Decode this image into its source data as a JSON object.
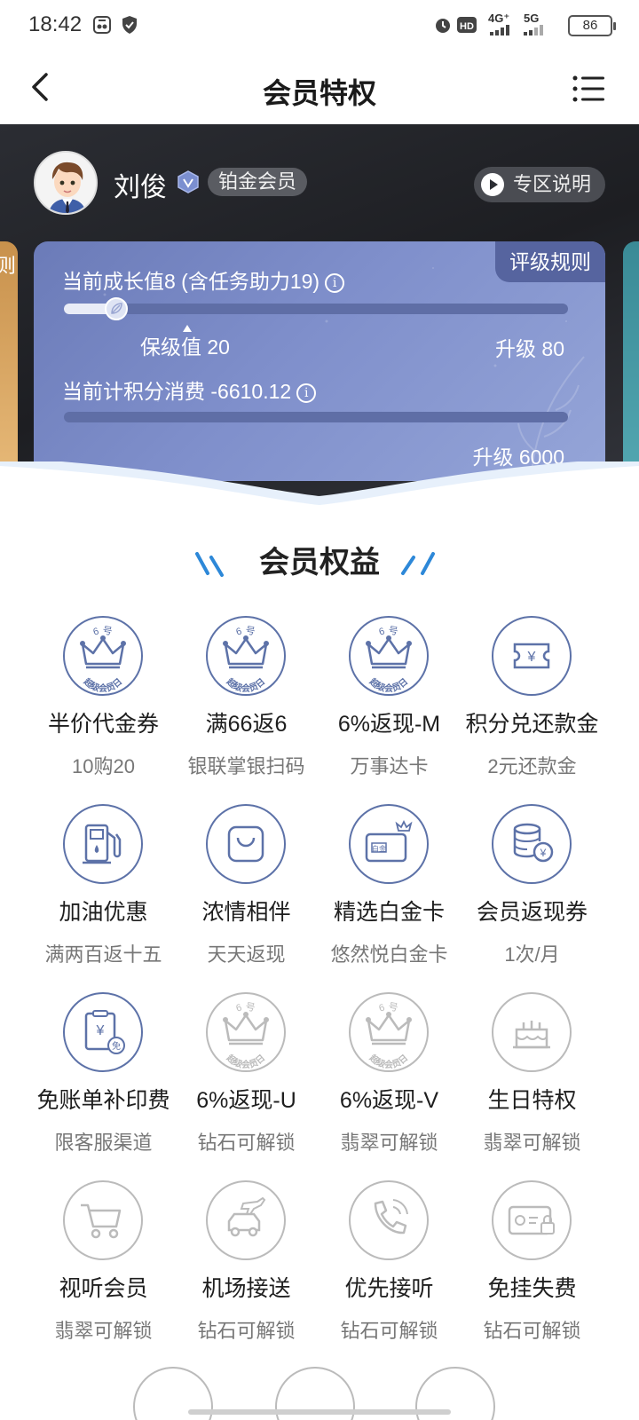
{
  "status_bar": {
    "time": "18:42",
    "battery": "86",
    "network_1": "4G⁺",
    "network_2": "5G",
    "hd_label": "HD"
  },
  "nav": {
    "title": "会员特权",
    "back_icon": "chevron-left-icon",
    "menu_icon": "list-menu-icon"
  },
  "user": {
    "name": "刘俊",
    "level_badge": "铂金会员",
    "zone_button": "专区说明"
  },
  "side_card_left_label": "则",
  "card": {
    "rules_tab": "评级规则",
    "growth_label": "当前成长值8 (含任务助力19)",
    "growth_progress": 0.1,
    "keep_label": "保级值 20",
    "upgrade_growth": "升级 80",
    "spend_label": "当前计积分消费 -6610.12",
    "spend_progress": 0.0,
    "upgrade_spend": "升级 6000",
    "info_glyph": "i"
  },
  "section": {
    "title": "会员权益"
  },
  "icon_texts": {
    "crown_top": "6  号",
    "crown_bottom": "超级会员日",
    "coupon_symbol": "¥",
    "card_text": "白金",
    "free_badge": "免"
  },
  "benefits": [
    {
      "title": "半价代金券",
      "subtitle": "10购20",
      "icon": "crown-6-icon",
      "locked": false
    },
    {
      "title": "满66返6",
      "subtitle": "银联掌银扫码",
      "icon": "crown-6-icon",
      "locked": false
    },
    {
      "title": "6%返现-M",
      "subtitle": "万事达卡",
      "icon": "crown-6-icon",
      "locked": false
    },
    {
      "title": "积分兑还款金",
      "subtitle": "2元还款金",
      "icon": "yen-ticket-icon",
      "locked": false
    },
    {
      "title": "加油优惠",
      "subtitle": "满两百返十五",
      "icon": "fuel-pump-icon",
      "locked": false
    },
    {
      "title": "浓情相伴",
      "subtitle": "天天返现",
      "icon": "shopping-bag-icon",
      "locked": false
    },
    {
      "title": "精选白金卡",
      "subtitle": "悠然悦白金卡",
      "icon": "platinum-card-icon",
      "locked": false
    },
    {
      "title": "会员返现券",
      "subtitle": "1次/月",
      "icon": "coin-stack-icon",
      "locked": false
    },
    {
      "title": "免账单补印费",
      "subtitle": "限客服渠道",
      "icon": "bill-free-icon",
      "locked": false
    },
    {
      "title": "6%返现-U",
      "subtitle": "钻石可解锁",
      "icon": "crown-6-icon",
      "locked": true
    },
    {
      "title": "6%返现-V",
      "subtitle": "翡翠可解锁",
      "icon": "crown-6-icon",
      "locked": true
    },
    {
      "title": "生日特权",
      "subtitle": "翡翠可解锁",
      "icon": "birthday-cake-icon",
      "locked": true
    },
    {
      "title": "视听会员",
      "subtitle": "翡翠可解锁",
      "icon": "shopping-cart-icon",
      "locked": true
    },
    {
      "title": "机场接送",
      "subtitle": "钻石可解锁",
      "icon": "plane-car-icon",
      "locked": true
    },
    {
      "title": "优先接听",
      "subtitle": "钻石可解锁",
      "icon": "phone-icon",
      "locked": true
    },
    {
      "title": "免挂失费",
      "subtitle": "钻石可解锁",
      "icon": "card-lock-icon",
      "locked": true
    }
  ],
  "colors": {
    "accent_blue": "#5d72a8",
    "locked_gray": "#bbbbbb",
    "card_blue": "#7f8fcb",
    "header_dark": "#1d1e22"
  }
}
